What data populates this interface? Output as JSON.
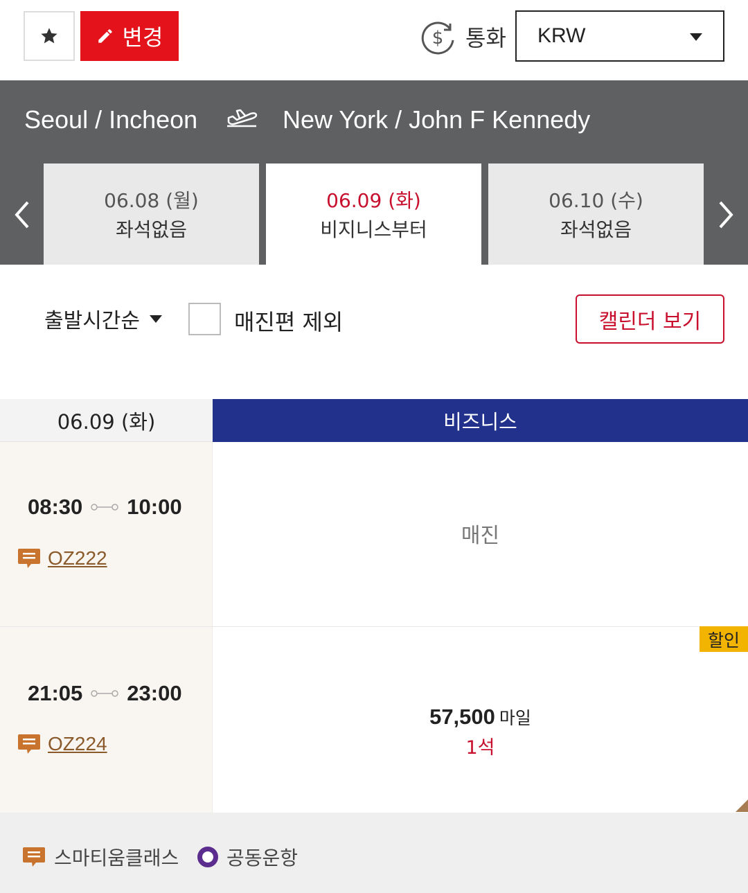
{
  "toolbar": {
    "change_label": "변경",
    "currency_label": "통화",
    "currency_value": "KRW"
  },
  "route": {
    "origin": "Seoul / Incheon",
    "destination": "New York / John F Kennedy"
  },
  "date_tabs": [
    {
      "date": "06.08 (월)",
      "status": "좌석없음"
    },
    {
      "date": "06.09 (화)",
      "status": "비지니스부터"
    },
    {
      "date": "06.10 (수)",
      "status": "좌석없음"
    }
  ],
  "filters": {
    "sort_label": "출발시간순",
    "exclude_soldout_label": "매진편 제외",
    "calendar_button": "캘린더 보기"
  },
  "table": {
    "date_header": "06.09 (화)",
    "class_header": "비즈니스",
    "flights": [
      {
        "depart": "08:30",
        "arrive": "10:00",
        "flight_no": "OZ222",
        "status": "매진"
      },
      {
        "depart": "21:05",
        "arrive": "23:00",
        "flight_no": "OZ224",
        "price": "57,500",
        "unit": "마일",
        "seats": "1석",
        "badge": "할인"
      }
    ]
  },
  "legend": {
    "smartium": "스마티움클래스",
    "codeshare": "공동운항"
  },
  "colors": {
    "brand_red": "#e3121b",
    "header_navy": "#22318c",
    "route_gray": "#5f6062",
    "discount_yellow": "#f2b400",
    "flight_brown": "#8a5a2b"
  }
}
